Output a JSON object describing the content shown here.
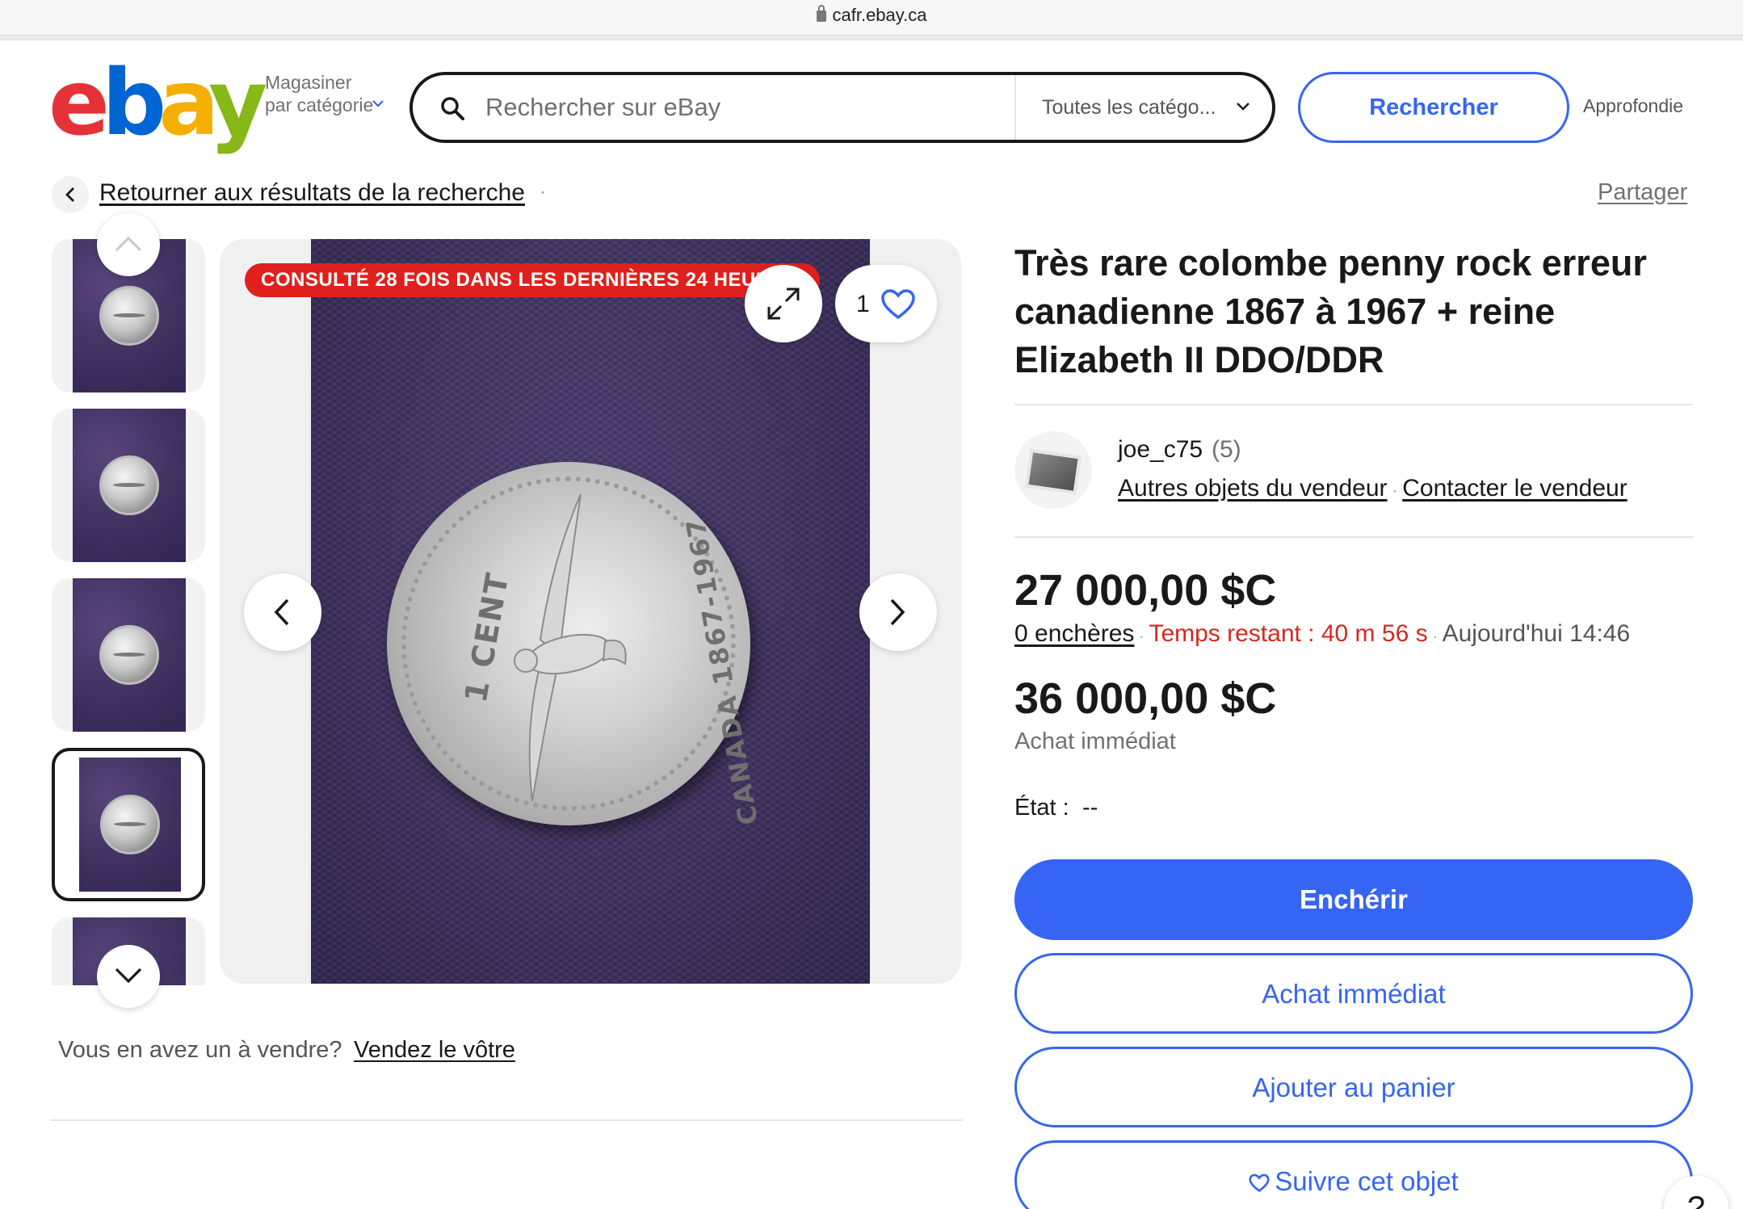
{
  "browser": {
    "url": "cafr.ebay.ca"
  },
  "header": {
    "shop_by_category": "Magasiner par catégorie",
    "search_placeholder": "Rechercher sur eBay",
    "category_select": "Toutes les catégo...",
    "search_button": "Rechercher",
    "advanced": "Approfondie"
  },
  "breadcrumb": {
    "back_link": "Retourner aux résultats de la recherche",
    "share": "Partager"
  },
  "gallery": {
    "views_badge": "CONSULTÉ 28 FOIS DANS LES DERNIÈRES 24 HEURES",
    "watch_count": "1",
    "coin_denomination": "1 CENT",
    "coin_legend": "CANADA 1867-1967",
    "selected_thumbnail": 4
  },
  "sell": {
    "question": "Vous en avez un à vendre?",
    "link": "Vendez le vôtre"
  },
  "item": {
    "title": "Très rare colombe penny rock erreur canadienne 1867 à 1967 + reine Elizabeth II DDO/DDR",
    "seller": {
      "name": "joe_c75",
      "score": "(5)",
      "other_items": "Autres objets du vendeur",
      "contact": "Contacter le vendeur"
    },
    "bid_price": "27 000,00 $C",
    "bids": "0 enchères",
    "time_left": "Temps restant : 40 m 56 s",
    "end_time": "Aujourd'hui 14:46",
    "buy_now_price": "36 000,00 $C",
    "buy_now_label": "Achat immédiat",
    "condition_label": "État :",
    "condition_value": "--"
  },
  "actions": {
    "bid": "Enchérir",
    "buy_now": "Achat immédiat",
    "add_to_cart": "Ajouter au panier",
    "watch": "Suivre cet objet"
  },
  "help": "?",
  "colors": {
    "accent": "#3665f3",
    "alert": "#d6281f",
    "badge": "#e0201c"
  }
}
